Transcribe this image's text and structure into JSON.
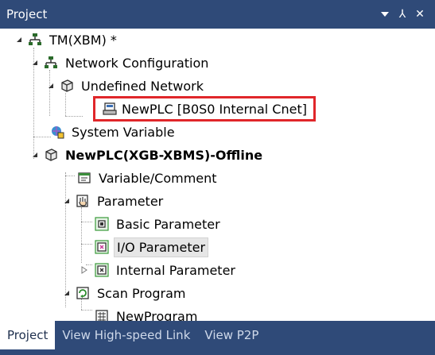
{
  "panel": {
    "title": "Project",
    "controls": {
      "dropdown_icon": "chevron-down-icon",
      "pin_label": "⅄",
      "close_label": "✕"
    }
  },
  "tree": {
    "root": "TM(XBM) *",
    "network_configuration": "Network Configuration",
    "undefined_network": "Undefined Network",
    "plc_network_node": "NewPLC [B0S0 Internal Cnet]",
    "system_variable": "System Variable",
    "plc_project": "NewPLC(XGB-XBMS)-Offline",
    "variable_comment": "Variable/Comment",
    "parameter": "Parameter",
    "basic_parameter": "Basic Parameter",
    "io_parameter": "I/O Parameter",
    "internal_parameter": "Internal Parameter",
    "scan_program": "Scan Program",
    "new_program": "NewProgram"
  },
  "tabs": [
    "Project",
    "View High-speed Link",
    "View P2P"
  ],
  "colors": {
    "titlebar": "#2f4a78",
    "highlight_border": "#e0262a",
    "selected_bg": "#e6e6e6"
  }
}
